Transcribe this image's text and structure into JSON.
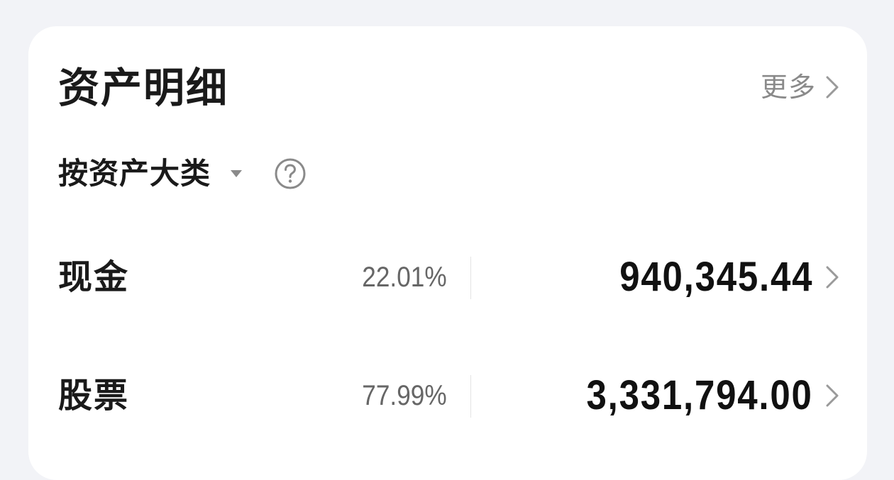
{
  "card": {
    "title": "资产明细",
    "more_label": "更多",
    "more_icon": "chevron-right-icon"
  },
  "filter": {
    "label": "按资产大类",
    "caret_icon": "caret-down-icon",
    "help_icon": "question-circle-icon"
  },
  "assets": [
    {
      "name": "现金",
      "percent": "22.01%",
      "value": "940,345.44",
      "icon": "chevron-right-icon"
    },
    {
      "name": "股票",
      "percent": "77.99%",
      "value": "3,331,794.00",
      "icon": "chevron-right-icon"
    }
  ],
  "colors": {
    "page_background": "#f2f3f7",
    "card_background": "#ffffff",
    "primary_text": "#1a1a1a",
    "secondary_text": "#8a8a8a",
    "percent_text": "#666666",
    "divider": "#e4e4e4"
  }
}
